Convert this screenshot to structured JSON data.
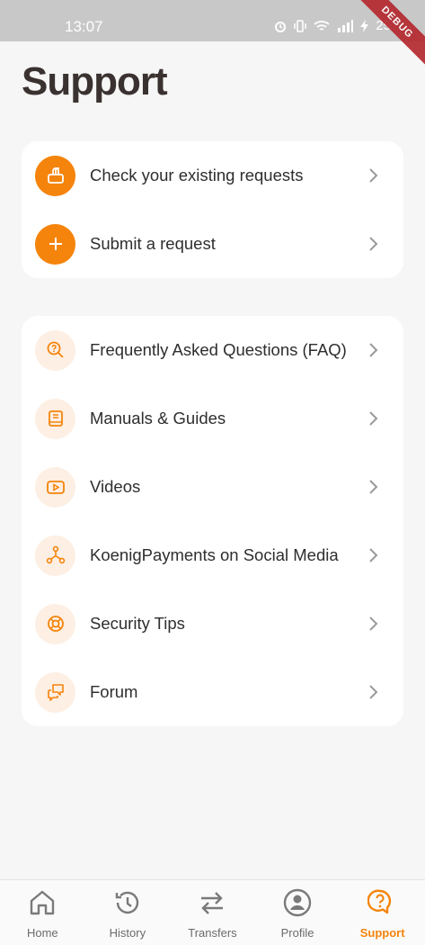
{
  "status_bar": {
    "time": "13:07",
    "battery": "25",
    "debug_label": "DEBUG"
  },
  "page": {
    "title": "Support"
  },
  "requests_card": {
    "items": [
      {
        "label": "Check your existing requests",
        "icon": "mailbox-icon"
      },
      {
        "label": "Submit a request",
        "icon": "plus-icon"
      }
    ]
  },
  "help_card": {
    "items": [
      {
        "label": "Frequently Asked Questions (FAQ)",
        "icon": "search-question-icon"
      },
      {
        "label": "Manuals & Guides",
        "icon": "book-icon"
      },
      {
        "label": "Videos",
        "icon": "play-video-icon"
      },
      {
        "label": "KoenigPayments on Social Media",
        "icon": "social-share-icon"
      },
      {
        "label": "Security Tips",
        "icon": "lifebuoy-icon"
      },
      {
        "label": "Forum",
        "icon": "chat-bubbles-icon"
      }
    ]
  },
  "bottom_nav": {
    "items": [
      {
        "label": "Home",
        "icon": "home-icon"
      },
      {
        "label": "History",
        "icon": "history-icon"
      },
      {
        "label": "Transfers",
        "icon": "transfer-arrows-icon"
      },
      {
        "label": "Profile",
        "icon": "profile-icon"
      },
      {
        "label": "Support",
        "icon": "support-question-icon"
      }
    ],
    "active": "Support"
  },
  "colors": {
    "accent": "#f5840c",
    "accent_soft": "#fdefe3",
    "background": "#f6f6f6",
    "title": "#3a3230"
  }
}
